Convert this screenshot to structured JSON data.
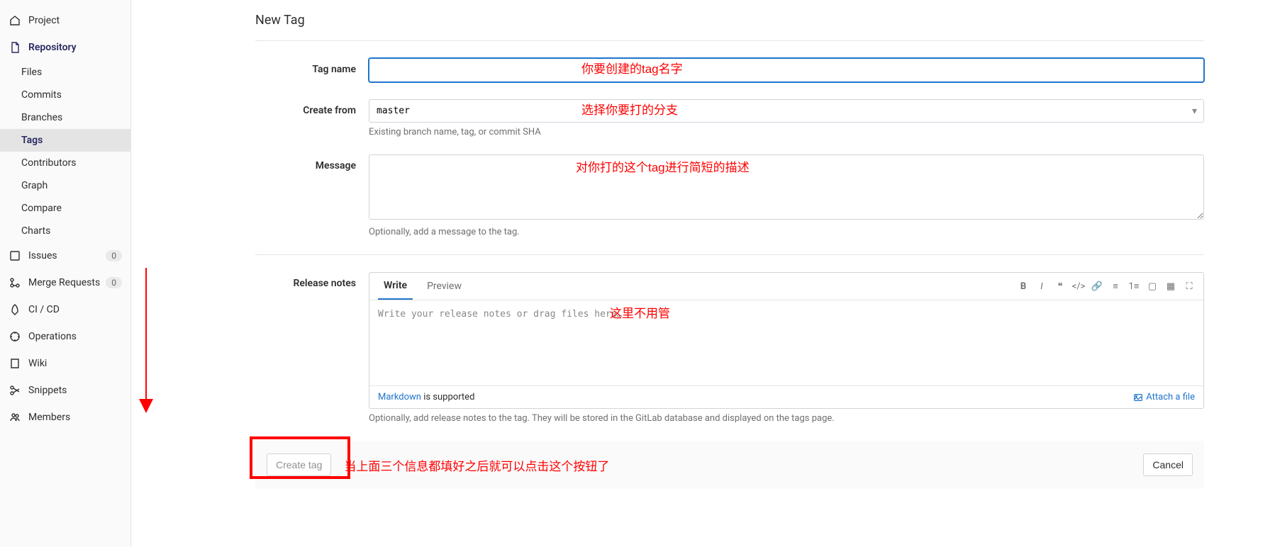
{
  "sidebar": {
    "project": "Project",
    "repository": "Repository",
    "repo_subs": [
      "Files",
      "Commits",
      "Branches",
      "Tags",
      "Contributors",
      "Graph",
      "Compare",
      "Charts"
    ],
    "issues": "Issues",
    "issues_badge": "0",
    "merge": "Merge Requests",
    "merge_badge": "0",
    "cicd": "CI / CD",
    "ops": "Operations",
    "wiki": "Wiki",
    "snippets": "Snippets",
    "members": "Members"
  },
  "main": {
    "title": "New Tag",
    "tag_name_label": "Tag name",
    "create_from_label": "Create from",
    "create_from_value": "master",
    "create_from_helper": "Existing branch name, tag, or commit SHA",
    "message_label": "Message",
    "message_helper": "Optionally, add a message to the tag.",
    "release_label": "Release notes",
    "write_tab": "Write",
    "preview_tab": "Preview",
    "release_placeholder": "Write your release notes or drag files here…",
    "markdown_link": "Markdown",
    "markdown_suffix": " is supported",
    "attach_file": "Attach a file",
    "release_helper": "Optionally, add release notes to the tag. They will be stored in the GitLab database and displayed on the tags page.",
    "create_btn": "Create tag",
    "cancel_btn": "Cancel"
  },
  "annotations": {
    "tag_name": "你要创建的tag名字",
    "create_from": "选择你要打的分支",
    "message": "对你打的这个tag进行简短的描述",
    "release": "这里不用管",
    "create": "当上面三个信息都填好之后就可以点击这个按钮了"
  }
}
